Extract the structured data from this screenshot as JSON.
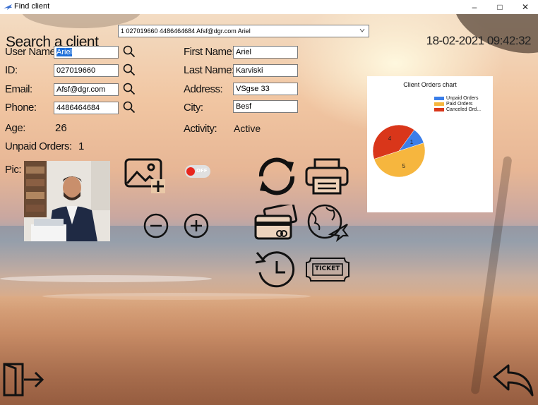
{
  "window": {
    "title": "Find client",
    "minimize": "–",
    "maximize": "□",
    "close": "✕"
  },
  "header": {
    "heading": "Search a client",
    "datetime": "18-02-2021 09:42:32"
  },
  "client_select": {
    "selected": "1 027019660 4486464684 Afsf@dgr.com Ariel"
  },
  "form": {
    "username_label": "User Name:",
    "username_value": "Ariel",
    "id_label": "ID:",
    "id_value": "027019660",
    "email_label": "Email:",
    "email_value": "Afsf@dgr.com",
    "phone_label": "Phone:",
    "phone_value": "4486464684",
    "age_label": "Age:",
    "age_value": "26",
    "unpaid_label": "Unpaid Orders:",
    "unpaid_value": "1",
    "pic_label": "Pic:",
    "firstname_label": "First Name:",
    "firstname_value": "Ariel",
    "lastname_label": "Last Name:",
    "lastname_value": "Karviski",
    "address_label": "Address:",
    "address_value": "VSgse 33",
    "city_label": "City:",
    "city_value": "Besf",
    "activity_label": "Activity:",
    "activity_value": "Active"
  },
  "toggle": {
    "label": "OFF",
    "state": "off"
  },
  "ticket_icon_text": "TICKET",
  "icons": {
    "add_image": "add-image-icon",
    "zoom_out": "minus-circle-icon",
    "zoom_in": "plus-circle-icon",
    "refresh": "refresh-icon",
    "print": "printer-icon",
    "payment": "credit-card-icon",
    "travel": "globe-plane-icon",
    "history": "history-icon",
    "tickets": "ticket-icon",
    "exit": "exit-door-icon",
    "back": "back-arrow-icon"
  },
  "colors": {
    "unpaid": "#3b7ee9",
    "paid": "#f6b63e",
    "canceled": "#d9361a",
    "selection": "#1e6fd9"
  },
  "chart_data": {
    "type": "pie",
    "title": "Client Orders chart",
    "categories": [
      "Unpaid Orders",
      "Paid Orders",
      "Canceled Ord..."
    ],
    "values": [
      1,
      5,
      4
    ],
    "legend_position": "top-right"
  }
}
